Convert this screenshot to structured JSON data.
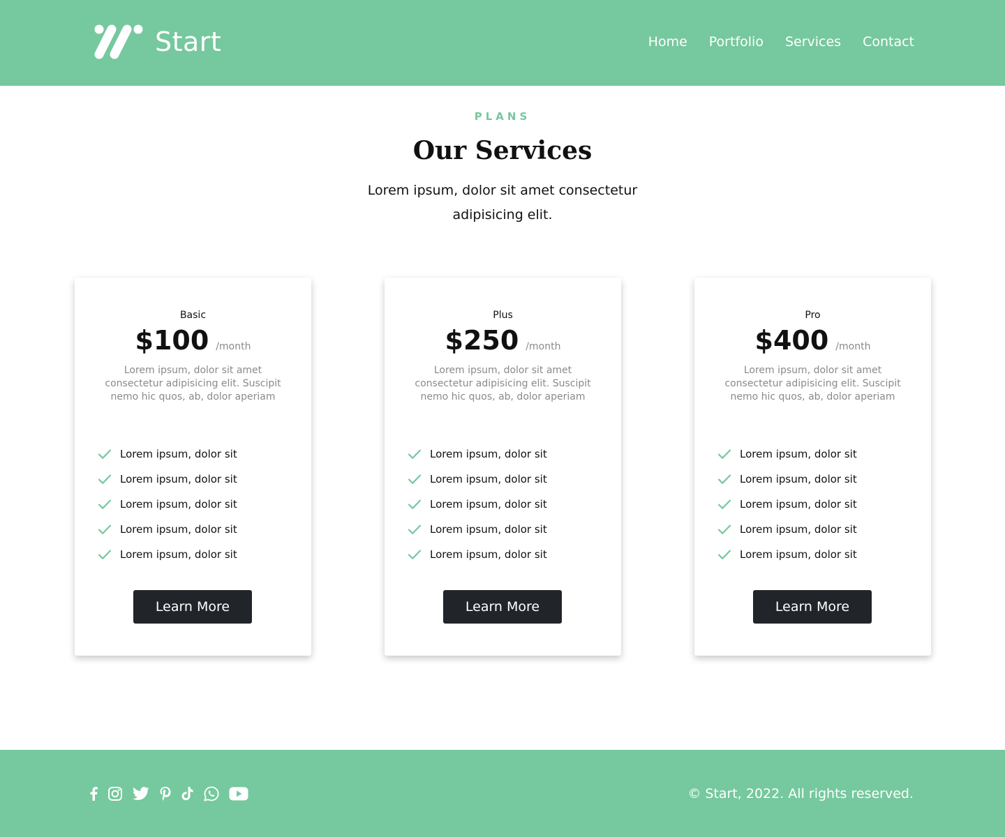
{
  "brand": {
    "name": "Start",
    "accent_color": "#76c89e",
    "button_color": "#212529"
  },
  "nav": {
    "items": [
      "Home",
      "Portfolio",
      "Services",
      "Contact"
    ]
  },
  "section": {
    "eyebrow": "PLANS",
    "title": "Our Services",
    "subtitle": "Lorem ipsum, dolor sit amet consectetur adipisicing elit."
  },
  "plans": [
    {
      "name": "Basic",
      "price": "$100",
      "period": "/month",
      "description": "Lorem ipsum, dolor sit amet consectetur adipisicing elit. Suscipit nemo hic quos, ab, dolor aperiam",
      "features": [
        "Lorem ipsum, dolor sit",
        "Lorem ipsum, dolor sit",
        "Lorem ipsum, dolor sit",
        "Lorem ipsum, dolor sit",
        "Lorem ipsum, dolor sit"
      ],
      "button": "Learn More"
    },
    {
      "name": "Plus",
      "price": "$250",
      "period": "/month",
      "description": "Lorem ipsum, dolor sit amet consectetur adipisicing elit. Suscipit nemo hic quos, ab, dolor aperiam",
      "features": [
        "Lorem ipsum, dolor sit",
        "Lorem ipsum, dolor sit",
        "Lorem ipsum, dolor sit",
        "Lorem ipsum, dolor sit",
        "Lorem ipsum, dolor sit"
      ],
      "button": "Learn More"
    },
    {
      "name": "Pro",
      "price": "$400",
      "period": "/month",
      "description": "Lorem ipsum, dolor sit amet consectetur adipisicing elit. Suscipit nemo hic quos, ab, dolor aperiam",
      "features": [
        "Lorem ipsum, dolor sit",
        "Lorem ipsum, dolor sit",
        "Lorem ipsum, dolor sit",
        "Lorem ipsum, dolor sit",
        "Lorem ipsum, dolor sit"
      ],
      "button": "Learn More"
    }
  ],
  "footer": {
    "social_icons": [
      "facebook-icon",
      "instagram-icon",
      "twitter-icon",
      "pinterest-icon",
      "tiktok-icon",
      "whatsapp-icon",
      "youtube-icon"
    ],
    "copyright": "© Start, 2022. All rights reserved."
  }
}
